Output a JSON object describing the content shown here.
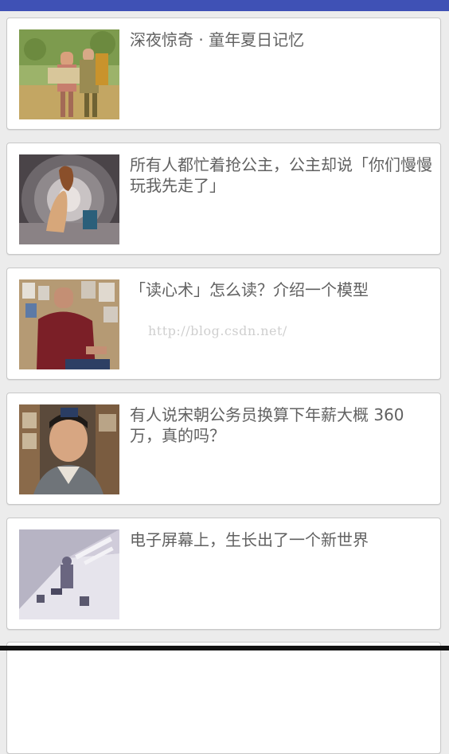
{
  "watermark": "http://blog.csdn.net/",
  "articles": [
    {
      "title": "深夜惊奇 · 童年夏日记忆"
    },
    {
      "title": "所有人都忙着抢公主，公主却说「你们慢慢玩我先走了」"
    },
    {
      "title": "「读心术」怎么读？介绍一个模型"
    },
    {
      "title": "有人说宋朝公务员换算下年薪大概 360 万，真的吗？"
    },
    {
      "title": "电子屏幕上，生长出了一个新世界"
    }
  ],
  "colors": {
    "status_bar": "#3f51b5",
    "background": "#ececec",
    "card": "#ffffff",
    "title_text": "#616161"
  }
}
